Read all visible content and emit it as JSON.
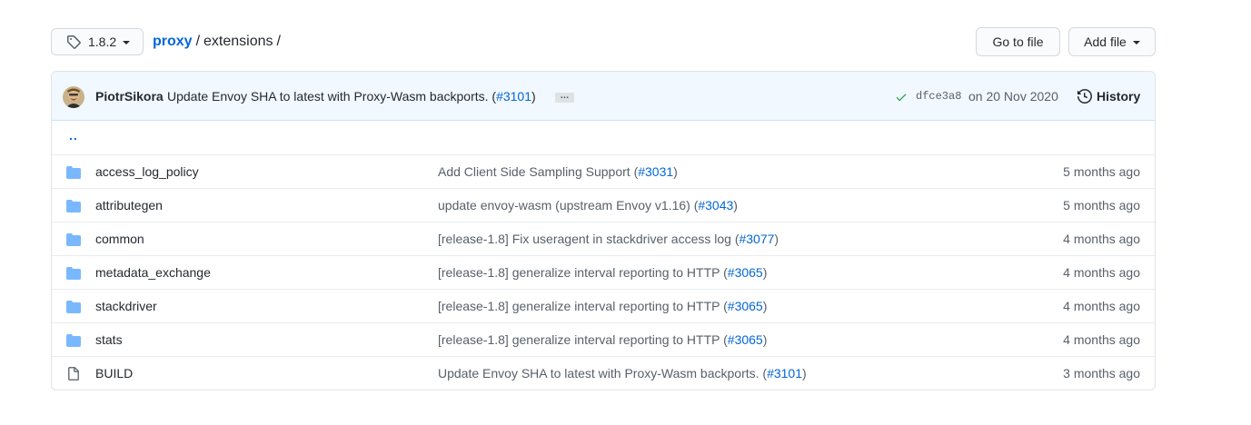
{
  "branch": {
    "label": "1.8.2"
  },
  "breadcrumb": {
    "repo": "proxy",
    "sep1": "/",
    "dir": "extensions",
    "sep2": "/"
  },
  "actions": {
    "goto_label": "Go to file",
    "add_label": "Add file"
  },
  "commit": {
    "author": "PiotrSikora",
    "message_prefix": "Update Envoy SHA to latest with Proxy-Wasm backports. (",
    "pr": "#3101",
    "message_suffix": ")",
    "ellipsis": "…",
    "sha": "dfce3a8",
    "date": "on 20 Nov 2020",
    "history_label": "History"
  },
  "updir": "..",
  "files": [
    {
      "type": "dir",
      "name": "access_log_policy",
      "msg": "Add Client Side Sampling Support (",
      "pr": "#3031",
      "suffix": ")",
      "age": "5 months ago"
    },
    {
      "type": "dir",
      "name": "attributegen",
      "msg": "update envoy-wasm (upstream Envoy v1.16) (",
      "pr": "#3043",
      "suffix": ")",
      "age": "5 months ago"
    },
    {
      "type": "dir",
      "name": "common",
      "msg": "[release-1.8] Fix useragent in stackdriver access log (",
      "pr": "#3077",
      "suffix": ")",
      "age": "4 months ago"
    },
    {
      "type": "dir",
      "name": "metadata_exchange",
      "msg": "[release-1.8] generalize interval reporting to HTTP (",
      "pr": "#3065",
      "suffix": ")",
      "age": "4 months ago"
    },
    {
      "type": "dir",
      "name": "stackdriver",
      "msg": "[release-1.8] generalize interval reporting to HTTP (",
      "pr": "#3065",
      "suffix": ")",
      "age": "4 months ago"
    },
    {
      "type": "dir",
      "name": "stats",
      "msg": "[release-1.8] generalize interval reporting to HTTP (",
      "pr": "#3065",
      "suffix": ")",
      "age": "4 months ago"
    },
    {
      "type": "file",
      "name": "BUILD",
      "msg": "Update Envoy SHA to latest with Proxy-Wasm backports. (",
      "pr": "#3101",
      "suffix": ")",
      "age": "3 months ago"
    }
  ],
  "colors": {
    "link": "#0366d6",
    "folder": "#79b8ff",
    "check": "#28a745",
    "commit_bg": "#f1f8ff"
  }
}
